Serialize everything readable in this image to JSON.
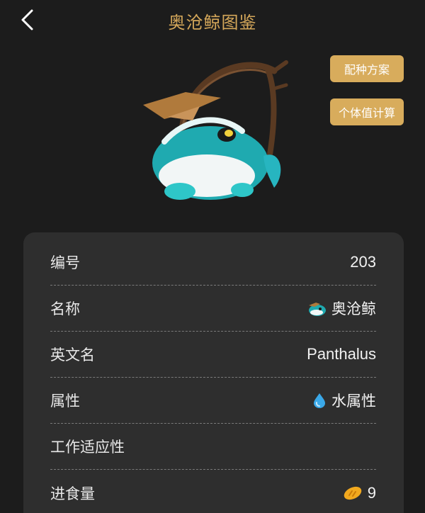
{
  "header": {
    "title": "奥沧鲸图鉴"
  },
  "actions": {
    "breeding_label": "配种方案",
    "iv_label": "个体值计算"
  },
  "colors": {
    "accent": "#d4a75a",
    "button": "#d8ac5c",
    "background": "#1c1c1c",
    "card": "#2e2e2e",
    "water": "#3aa8e8",
    "food": "#f2a91e"
  },
  "details": {
    "number_label": "编号",
    "number_value": "203",
    "name_label": "名称",
    "name_value": "奥沧鲸",
    "english_label": "英文名",
    "english_value": "Panthalus",
    "element_label": "属性",
    "element_value": "水属性",
    "element_icon": "water-drop-icon",
    "work_label": "工作适应性",
    "food_label": "进食量",
    "food_value": "9",
    "food_icon": "bread-icon"
  }
}
